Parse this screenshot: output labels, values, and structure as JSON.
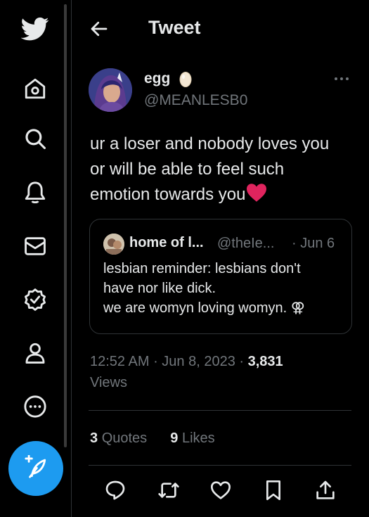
{
  "header": {
    "title": "Tweet"
  },
  "tweet": {
    "display_name": "egg",
    "handle": "@MEANLESB0",
    "text_line1": "ur a loser and nobody loves you",
    "text_line2": "or will be able to feel such",
    "text_line3": "emotion towards you",
    "time": "12:52 AM",
    "date": "Jun 8, 2023",
    "view_count": "3,831",
    "views_label": "Views",
    "quotes_count": "3",
    "quotes_label": "Quotes",
    "likes_count": "9",
    "likes_label": "Likes"
  },
  "quoted": {
    "display_name": "home of l...",
    "handle": "@theIe...",
    "date": "· Jun 6",
    "line1": "lesbian reminder: lesbians don't",
    "line2": "have nor like dick.",
    "line3": "we are womyn loving womyn. ⚢"
  },
  "icons": [
    "twitter-logo-icon",
    "home-icon",
    "search-icon",
    "bell-icon",
    "mail-icon",
    "verified-icon",
    "profile-icon",
    "more-circle-icon",
    "compose-icon",
    "back-arrow-icon",
    "more-dots-icon",
    "reply-icon",
    "retweet-icon",
    "like-icon",
    "bookmark-icon",
    "share-icon",
    "heart-emoji",
    "egg-emoji"
  ],
  "colors": {
    "background": "#000000",
    "accent": "#1d9bf0",
    "text": "#e7e9ea",
    "secondary": "#71767b",
    "border": "#2f3336",
    "heart": "#e0245e"
  }
}
